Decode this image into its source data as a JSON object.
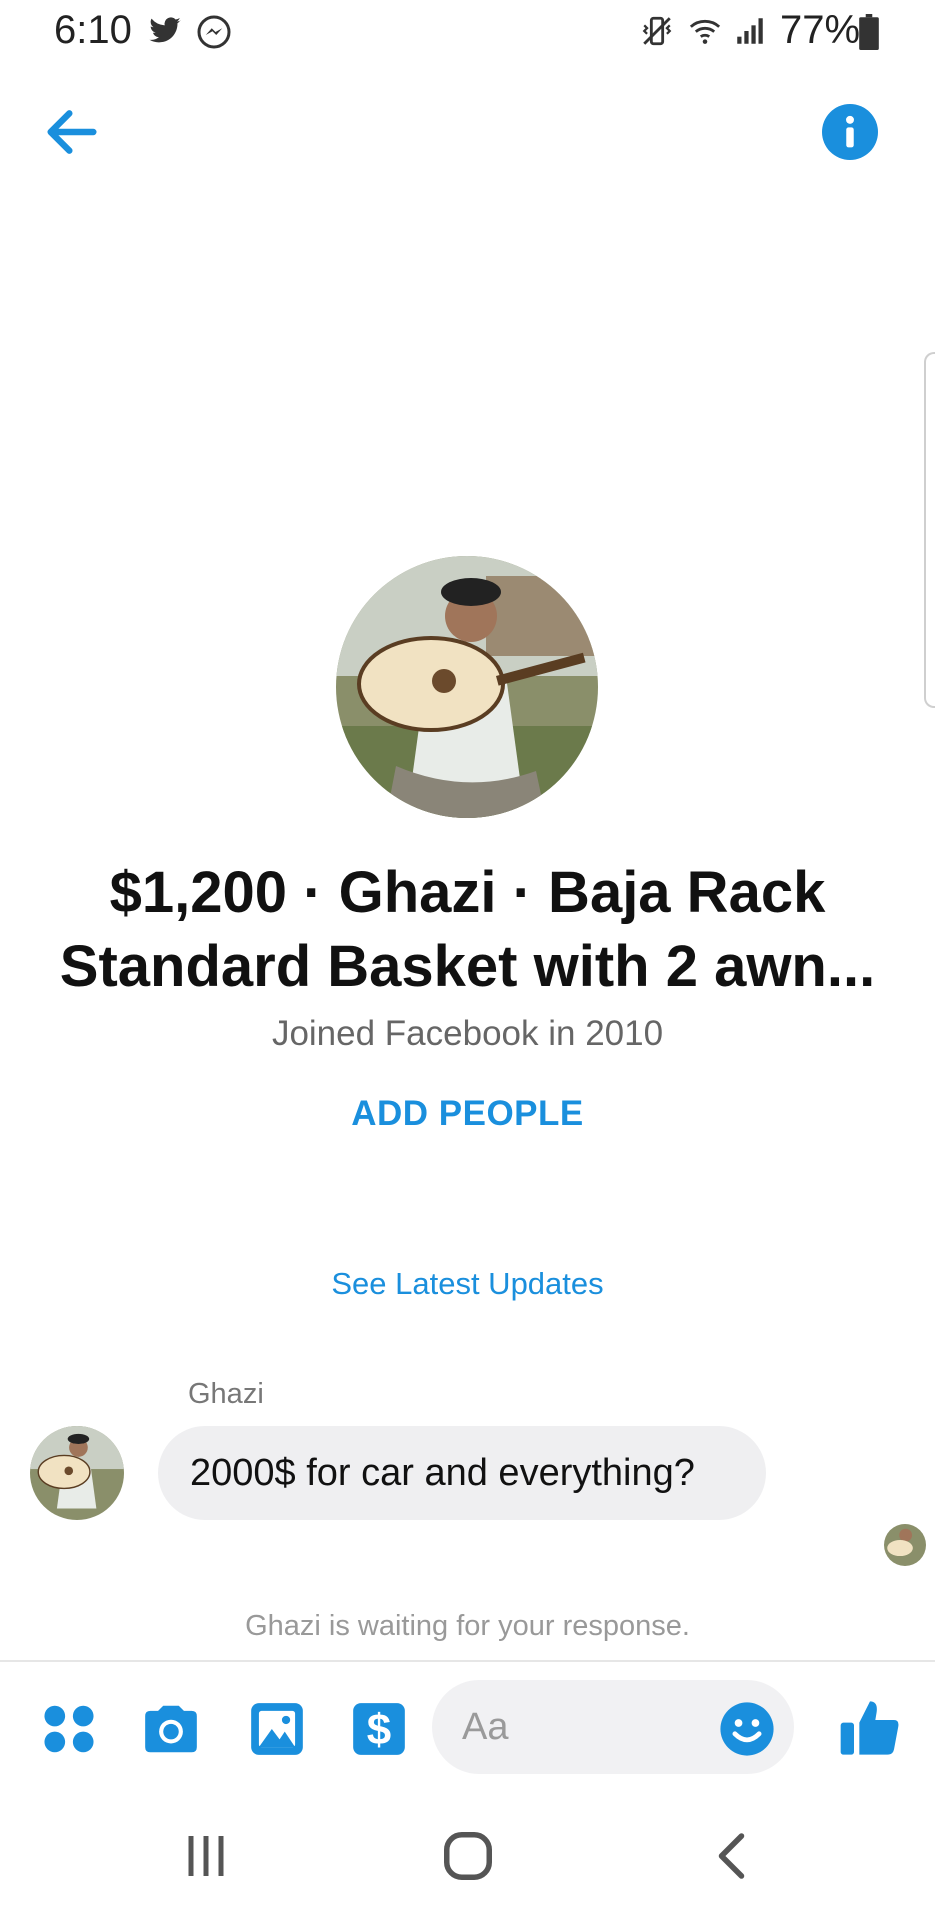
{
  "status_bar": {
    "time": "6:10",
    "battery": "77%",
    "icons": [
      "twitter-icon",
      "messenger-icon",
      "vibrate-icon",
      "wifi-icon",
      "signal-icon",
      "battery-icon"
    ]
  },
  "header": {
    "back_icon": "arrow-left-icon",
    "info_icon": "info-icon"
  },
  "profile": {
    "title": "$1,200 · Ghazi · Baja Rack Standard Basket with 2 awn...",
    "joined": "Joined Facebook in 2010",
    "add_people": "ADD PEOPLE"
  },
  "thread": {
    "see_updates": "See Latest Updates",
    "sender": "Ghazi",
    "message": "2000$ for car and everything?",
    "waiting": "Ghazi is waiting for your response."
  },
  "composer": {
    "placeholder": "Aa",
    "tools": [
      "menu-dots-icon",
      "camera-icon",
      "image-icon",
      "dollar-icon"
    ],
    "emoji_icon": "smiley-icon",
    "like_icon": "thumbs-up-icon"
  },
  "nav": {
    "buttons": [
      "recent-apps-icon",
      "home-icon",
      "back-chevron-icon"
    ]
  },
  "colors": {
    "accent": "#1a8fdd",
    "bubble": "#efeff1"
  }
}
